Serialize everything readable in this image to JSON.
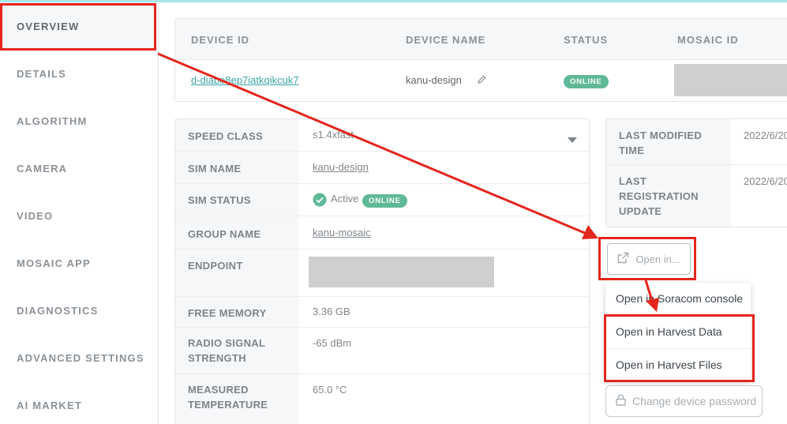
{
  "sidebar": {
    "items": [
      {
        "label": "OVERVIEW"
      },
      {
        "label": "DETAILS"
      },
      {
        "label": "ALGORITHM"
      },
      {
        "label": "CAMERA"
      },
      {
        "label": "VIDEO"
      },
      {
        "label": "MOSAIC APP"
      },
      {
        "label": "DIAGNOSTICS"
      },
      {
        "label": "ADVANCED SETTINGS"
      },
      {
        "label": "AI MARKET"
      }
    ],
    "active": "OVERVIEW"
  },
  "device_table": {
    "headers": [
      "DEVICE ID",
      "DEVICE NAME",
      "STATUS",
      "MOSAIC ID"
    ],
    "row": {
      "device_id": "d-diabo8ep7iatkqikcuk7",
      "device_name": "kanu-design",
      "status": "ONLINE"
    }
  },
  "details": {
    "rows": [
      {
        "label": "SPEED CLASS",
        "value": "s1.4xfast"
      },
      {
        "label": "SIM NAME",
        "value": "kanu-design"
      },
      {
        "label": "SIM STATUS",
        "value": "Active",
        "badge": "ONLINE"
      },
      {
        "label": "GROUP NAME",
        "value": "kanu-mosaic"
      },
      {
        "label": "ENDPOINT",
        "value": ""
      },
      {
        "label": "FREE MEMORY",
        "value": "3.36 GB"
      },
      {
        "label": "RADIO SIGNAL STRENGTH",
        "value": "-65 dBm"
      },
      {
        "label": "MEASURED TEMPERATURE",
        "value": "65.0 °C"
      }
    ]
  },
  "timestamps": {
    "last_modified_label": "LAST MODIFIED TIME",
    "last_modified_value": "2022/6/20",
    "last_registration_label": "LAST REGISTRATION UPDATE",
    "last_registration_value": "2022/6/20"
  },
  "actions": {
    "open_in_label": "Open in...",
    "menu": [
      "Open in Soracom console",
      "Open in Harvest Data",
      "Open in Harvest Files"
    ],
    "change_password_label": "Change device password"
  },
  "colors": {
    "accent": "#3aa3a3",
    "online_badge": "#5fb996",
    "annotation": "#e3261e"
  },
  "icons": [
    "edit-pencil-icon",
    "check-circle-icon",
    "chevron-down-icon",
    "external-link-icon",
    "lock-icon"
  ]
}
